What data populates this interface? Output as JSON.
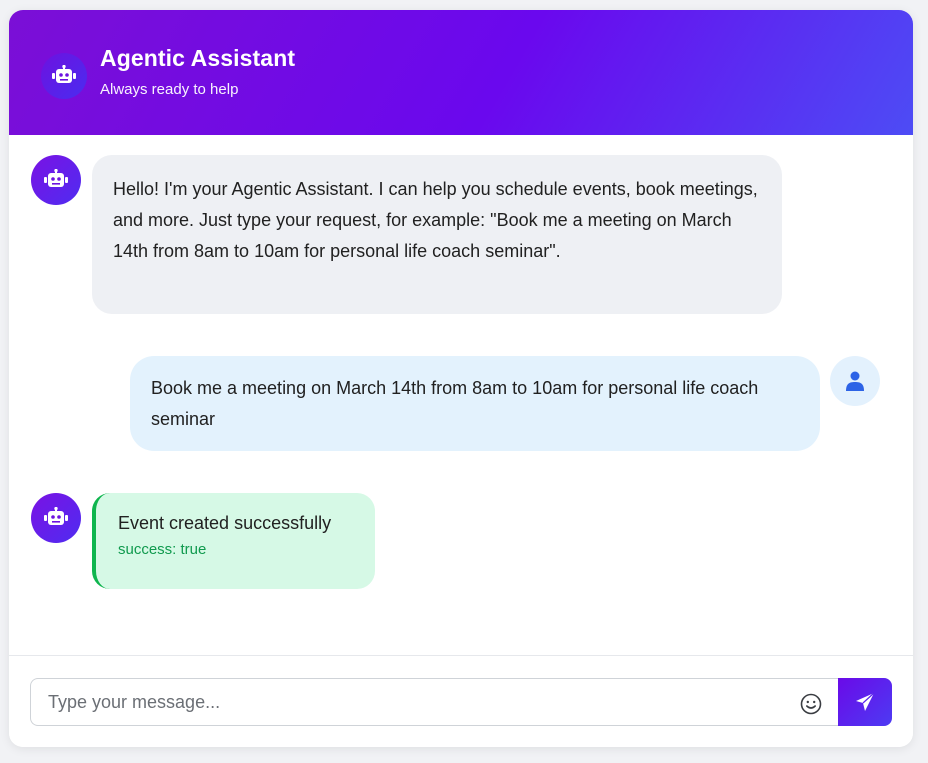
{
  "header": {
    "title": "Agentic Assistant",
    "subtitle": "Always ready to help",
    "avatar_icon": "robot-icon"
  },
  "messages": [
    {
      "sender": "bot",
      "icon": "robot-icon",
      "text": "Hello! I'm your Agentic Assistant. I can help you schedule events, book meetings, and more. Just type your request, for example: \"Book me a meeting on March 14th from 8am to 10am for personal life coach seminar\"."
    },
    {
      "sender": "user",
      "icon": "user-icon",
      "text": "Book me a meeting on March 14th from 8am to 10am for personal life coach seminar"
    },
    {
      "sender": "bot",
      "icon": "robot-icon",
      "status": "success",
      "text": "Event created successfully",
      "meta": "success: true"
    }
  ],
  "composer": {
    "placeholder": "Type your message...",
    "value": "",
    "emoji_icon": "smiley-icon",
    "send_icon": "paper-plane-icon"
  },
  "colors": {
    "accent": "#6a0ae8",
    "header_gradient_start": "#7b0fd6",
    "header_gradient_end": "#4d4cf5",
    "bot_bubble": "#eef0f4",
    "user_bubble": "#e3f2fd",
    "success_bubble": "#d6f9e6",
    "success_border": "#0fb54e",
    "success_text": "#109a4e"
  }
}
